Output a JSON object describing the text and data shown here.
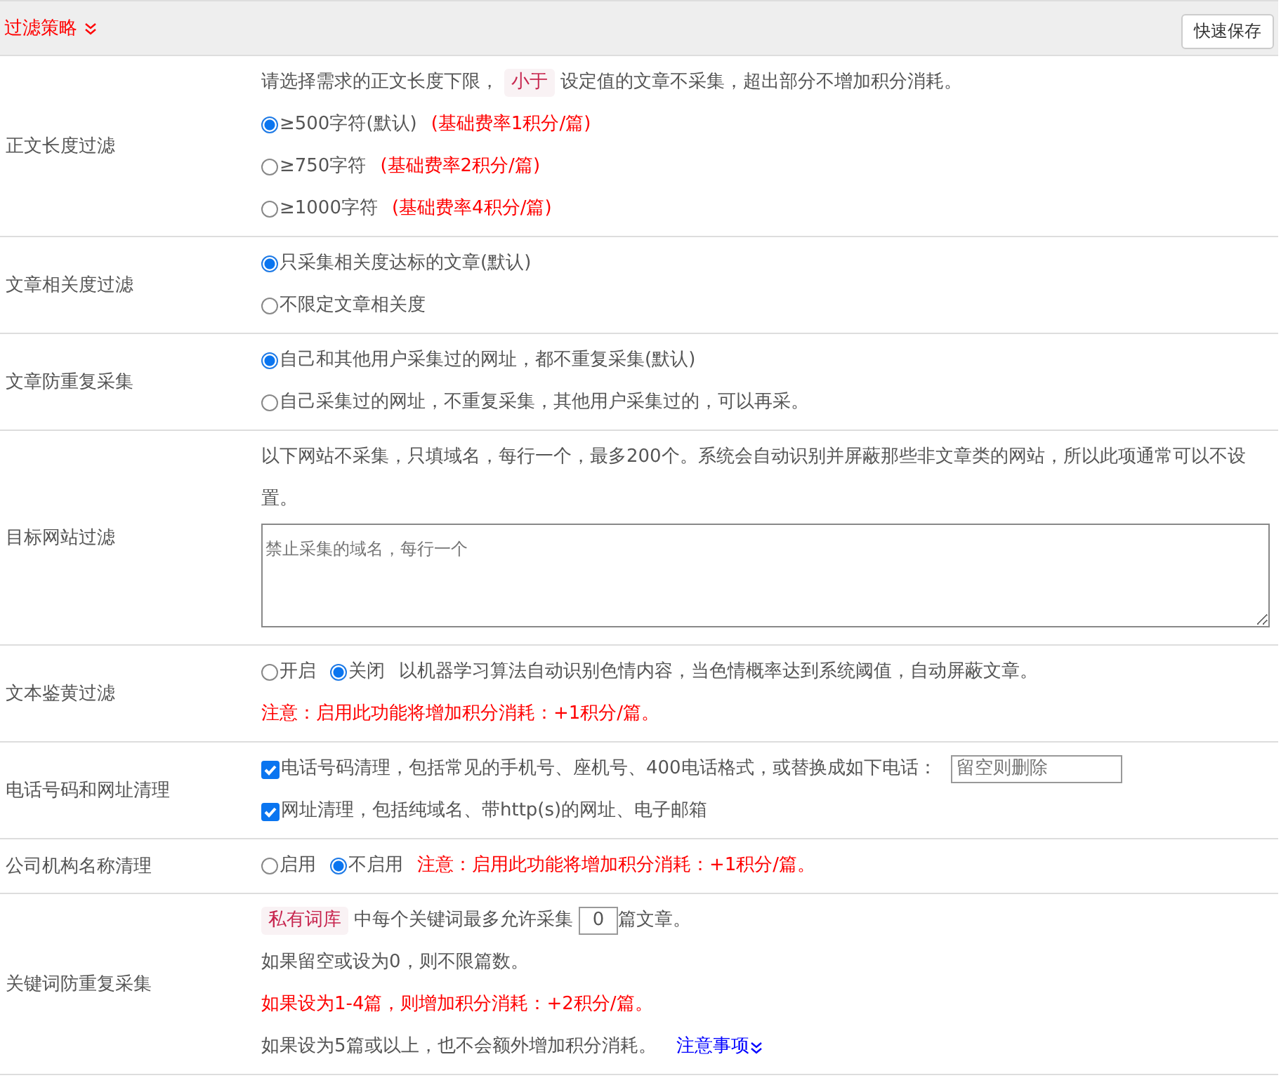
{
  "header": {
    "title": "过滤策略",
    "save_button": "快速保存"
  },
  "rows": [
    {
      "label": "正文长度过滤",
      "lines": [
        {
          "segments": [
            {
              "kind": "text",
              "text": "请选择需求的正文长度下限，"
            },
            {
              "kind": "tag",
              "text": "小于"
            },
            {
              "kind": "text",
              "text": "设定值的文章不采集，超出部分不增加积分消耗。"
            }
          ]
        },
        {
          "segments": [
            {
              "kind": "radio",
              "text": "≥500字符(默认)",
              "selected": true
            },
            {
              "kind": "warn",
              "text": "(基础费率1积分/篇)"
            }
          ]
        },
        {
          "segments": [
            {
              "kind": "radio",
              "text": "≥750字符",
              "selected": false
            },
            {
              "kind": "warn",
              "text": "(基础费率2积分/篇)"
            }
          ]
        },
        {
          "segments": [
            {
              "kind": "radio",
              "text": "≥1000字符",
              "selected": false
            },
            {
              "kind": "warn",
              "text": "(基础费率4积分/篇)"
            }
          ]
        }
      ]
    },
    {
      "label": "文章相关度过滤",
      "lines": [
        {
          "segments": [
            {
              "kind": "radio",
              "text": "只采集相关度达标的文章(默认)",
              "selected": true
            }
          ]
        },
        {
          "segments": [
            {
              "kind": "radio",
              "text": "不限定文章相关度",
              "selected": false
            }
          ]
        }
      ]
    },
    {
      "label": "文章防重复采集",
      "lines": [
        {
          "segments": [
            {
              "kind": "radio",
              "text": "自己和其他用户采集过的网址，都不重复采集(默认)",
              "selected": true
            }
          ]
        },
        {
          "segments": [
            {
              "kind": "radio",
              "text": "自己采集过的网址，不重复采集，其他用户采集过的，可以再采。",
              "selected": false
            }
          ]
        }
      ]
    },
    {
      "label": "目标网站过滤",
      "lines": [
        {
          "segments": [
            {
              "kind": "text",
              "text": "以下网站不采集，只填域名，每行一个，最多200个。系统会自动识别并屏蔽那些非文章类的网站，所以此项通常可以不设置。"
            }
          ]
        },
        {
          "segments": [
            {
              "kind": "textarea",
              "placeholder": "禁止采集的域名，每行一个"
            }
          ]
        }
      ]
    },
    {
      "label": "文本鉴黄过滤",
      "lines": [
        {
          "segments": [
            {
              "kind": "radio",
              "text": "开启",
              "selected": false
            },
            {
              "kind": "radio",
              "text": "关闭",
              "selected": true
            },
            {
              "kind": "text",
              "text": "以机器学习算法自动识别色情内容，当色情概率达到系统阈值，自动屏蔽文章。"
            }
          ]
        },
        {
          "segments": [
            {
              "kind": "warn",
              "text": "注意：启用此功能将增加积分消耗：+1积分/篇。"
            }
          ]
        }
      ]
    },
    {
      "label": "电话号码和网址清理",
      "lines": [
        {
          "segments": [
            {
              "kind": "checkbox",
              "text": "电话号码清理，包括常见的手机号、座机号、400电话格式，或替换成如下电话：",
              "checked": true
            },
            {
              "kind": "input",
              "placeholder": "留空则删除"
            }
          ]
        },
        {
          "segments": [
            {
              "kind": "checkbox",
              "text": "网址清理，包括纯域名、带http(s)的网址、电子邮箱",
              "checked": true
            }
          ]
        }
      ]
    },
    {
      "label": "公司机构名称清理",
      "lines": [
        {
          "segments": [
            {
              "kind": "radio",
              "text": "启用",
              "selected": false
            },
            {
              "kind": "radio",
              "text": "不启用",
              "selected": true
            },
            {
              "kind": "warn",
              "text": "注意：启用此功能将增加积分消耗：+1积分/篇。"
            }
          ]
        }
      ]
    },
    {
      "label": "关键词防重复采集",
      "lines": [
        {
          "segments": [
            {
              "kind": "tag",
              "text": "私有词库"
            },
            {
              "kind": "text",
              "text": "中每个关键词最多允许采集"
            },
            {
              "kind": "number",
              "value": "0"
            },
            {
              "kind": "text",
              "text": "篇文章。"
            }
          ]
        },
        {
          "segments": [
            {
              "kind": "text",
              "text": "如果留空或设为0，则不限篇数。"
            }
          ]
        },
        {
          "segments": [
            {
              "kind": "warn",
              "text": "如果设为1-4篇，则增加积分消耗：+2积分/篇。"
            }
          ]
        },
        {
          "segments": [
            {
              "kind": "text",
              "text": "如果设为5篇或以上，也不会额外增加积分消耗。"
            },
            {
              "kind": "link",
              "text": "注意事项"
            }
          ]
        }
      ]
    }
  ]
}
